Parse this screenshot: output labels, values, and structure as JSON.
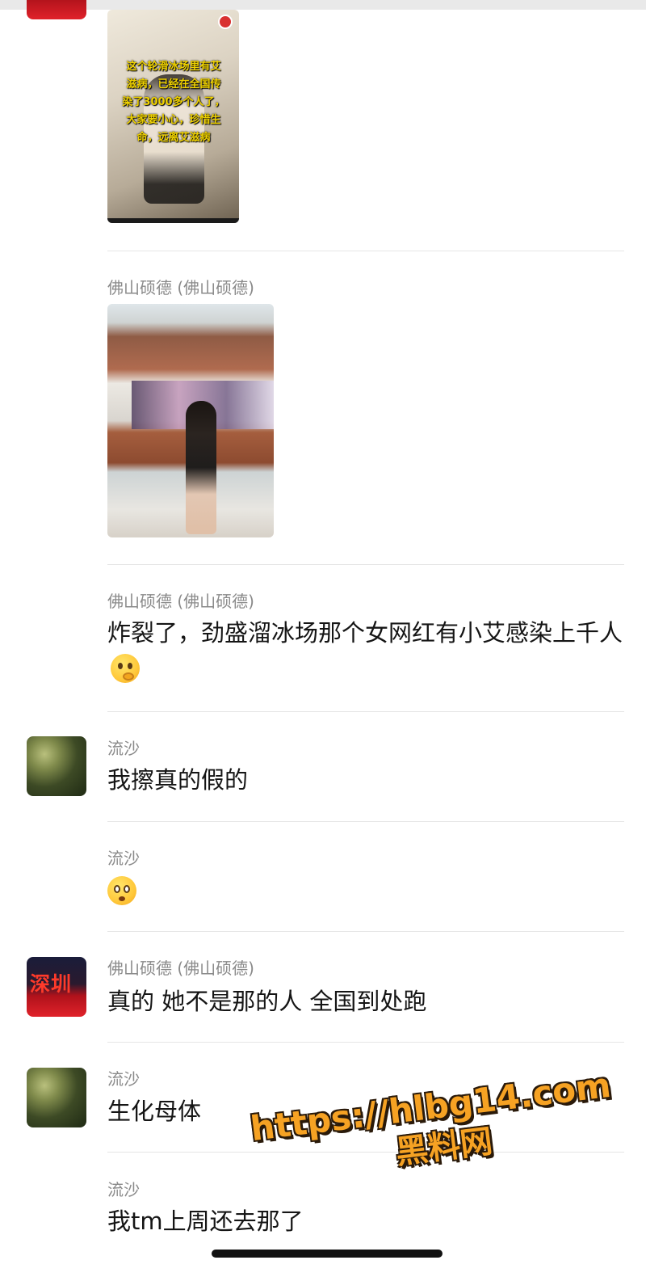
{
  "video_message": {
    "caption": "这个轮滑冰场里有艾滋病，已经在全国传染了3000多个人了，大家要小心，珍惜生命，远离艾滋病"
  },
  "messages": [
    {
      "sender": "佛山硕德 (佛山硕德)",
      "type": "image"
    },
    {
      "sender": "佛山硕德 (佛山硕德)",
      "text": "炸裂了，劲盛溜冰场那个女网红有小艾感染上千人",
      "emoji": "face-with-hand-over-mouth"
    },
    {
      "sender": "流沙",
      "text": "我擦真的假的"
    },
    {
      "sender": "流沙",
      "emoji": "flushed-face"
    },
    {
      "sender": "佛山硕德 (佛山硕德)",
      "text": "真的 她不是那的人 全国到处跑"
    },
    {
      "sender": "流沙",
      "text": "生化母体"
    },
    {
      "sender": "流沙",
      "text": "我tm上周还去那了"
    }
  ],
  "avatars": {
    "foshan": {
      "text": "深圳",
      "color": "#d32029"
    },
    "liusha": {
      "color": "#4a5a2e"
    }
  },
  "watermark": {
    "url": "https://hlbg14.com",
    "name": "黑料网"
  }
}
